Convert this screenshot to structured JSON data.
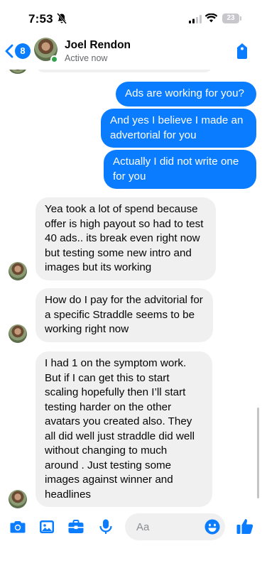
{
  "status_bar": {
    "time": "7:53",
    "battery_level": "23"
  },
  "header": {
    "unread_count": "8",
    "contact_name": "Joel Rendon",
    "contact_status": "Active now"
  },
  "messages": [
    {
      "direction": "outgoing",
      "text": "Ads are working for you?"
    },
    {
      "direction": "outgoing",
      "text": "And yes I believe I made an advertorial for you"
    },
    {
      "direction": "outgoing",
      "text": "Actually I did not write one for you"
    },
    {
      "direction": "incoming",
      "text": "Yea took a lot of spend because offer is high payout so had to test 40 ads.. its break even right now but testing some new intro and images but its working"
    },
    {
      "direction": "incoming",
      "text": "How do I pay for the advitorial for a specific Straddle seems to be working right now"
    },
    {
      "direction": "incoming",
      "text": "I had 1 on the symptom work. But if I can get this to start scaling hopefully then I’ll start testing harder on the other avatars you created also. They all did well just straddle did well without changing to much around . Just testing some images against winner and headlines"
    }
  ],
  "composer": {
    "placeholder": "Aa"
  },
  "colors": {
    "accent": "#0a7cff",
    "incoming_bubble": "#f0f0f0",
    "online": "#31a24c"
  },
  "icons": [
    "bell-off-icon",
    "signal-icon",
    "wifi-icon",
    "battery-icon",
    "back-chevron-icon",
    "tag-icon",
    "camera-icon",
    "gallery-icon",
    "toolbox-icon",
    "microphone-icon",
    "emoji-icon",
    "thumbs-up-icon"
  ]
}
